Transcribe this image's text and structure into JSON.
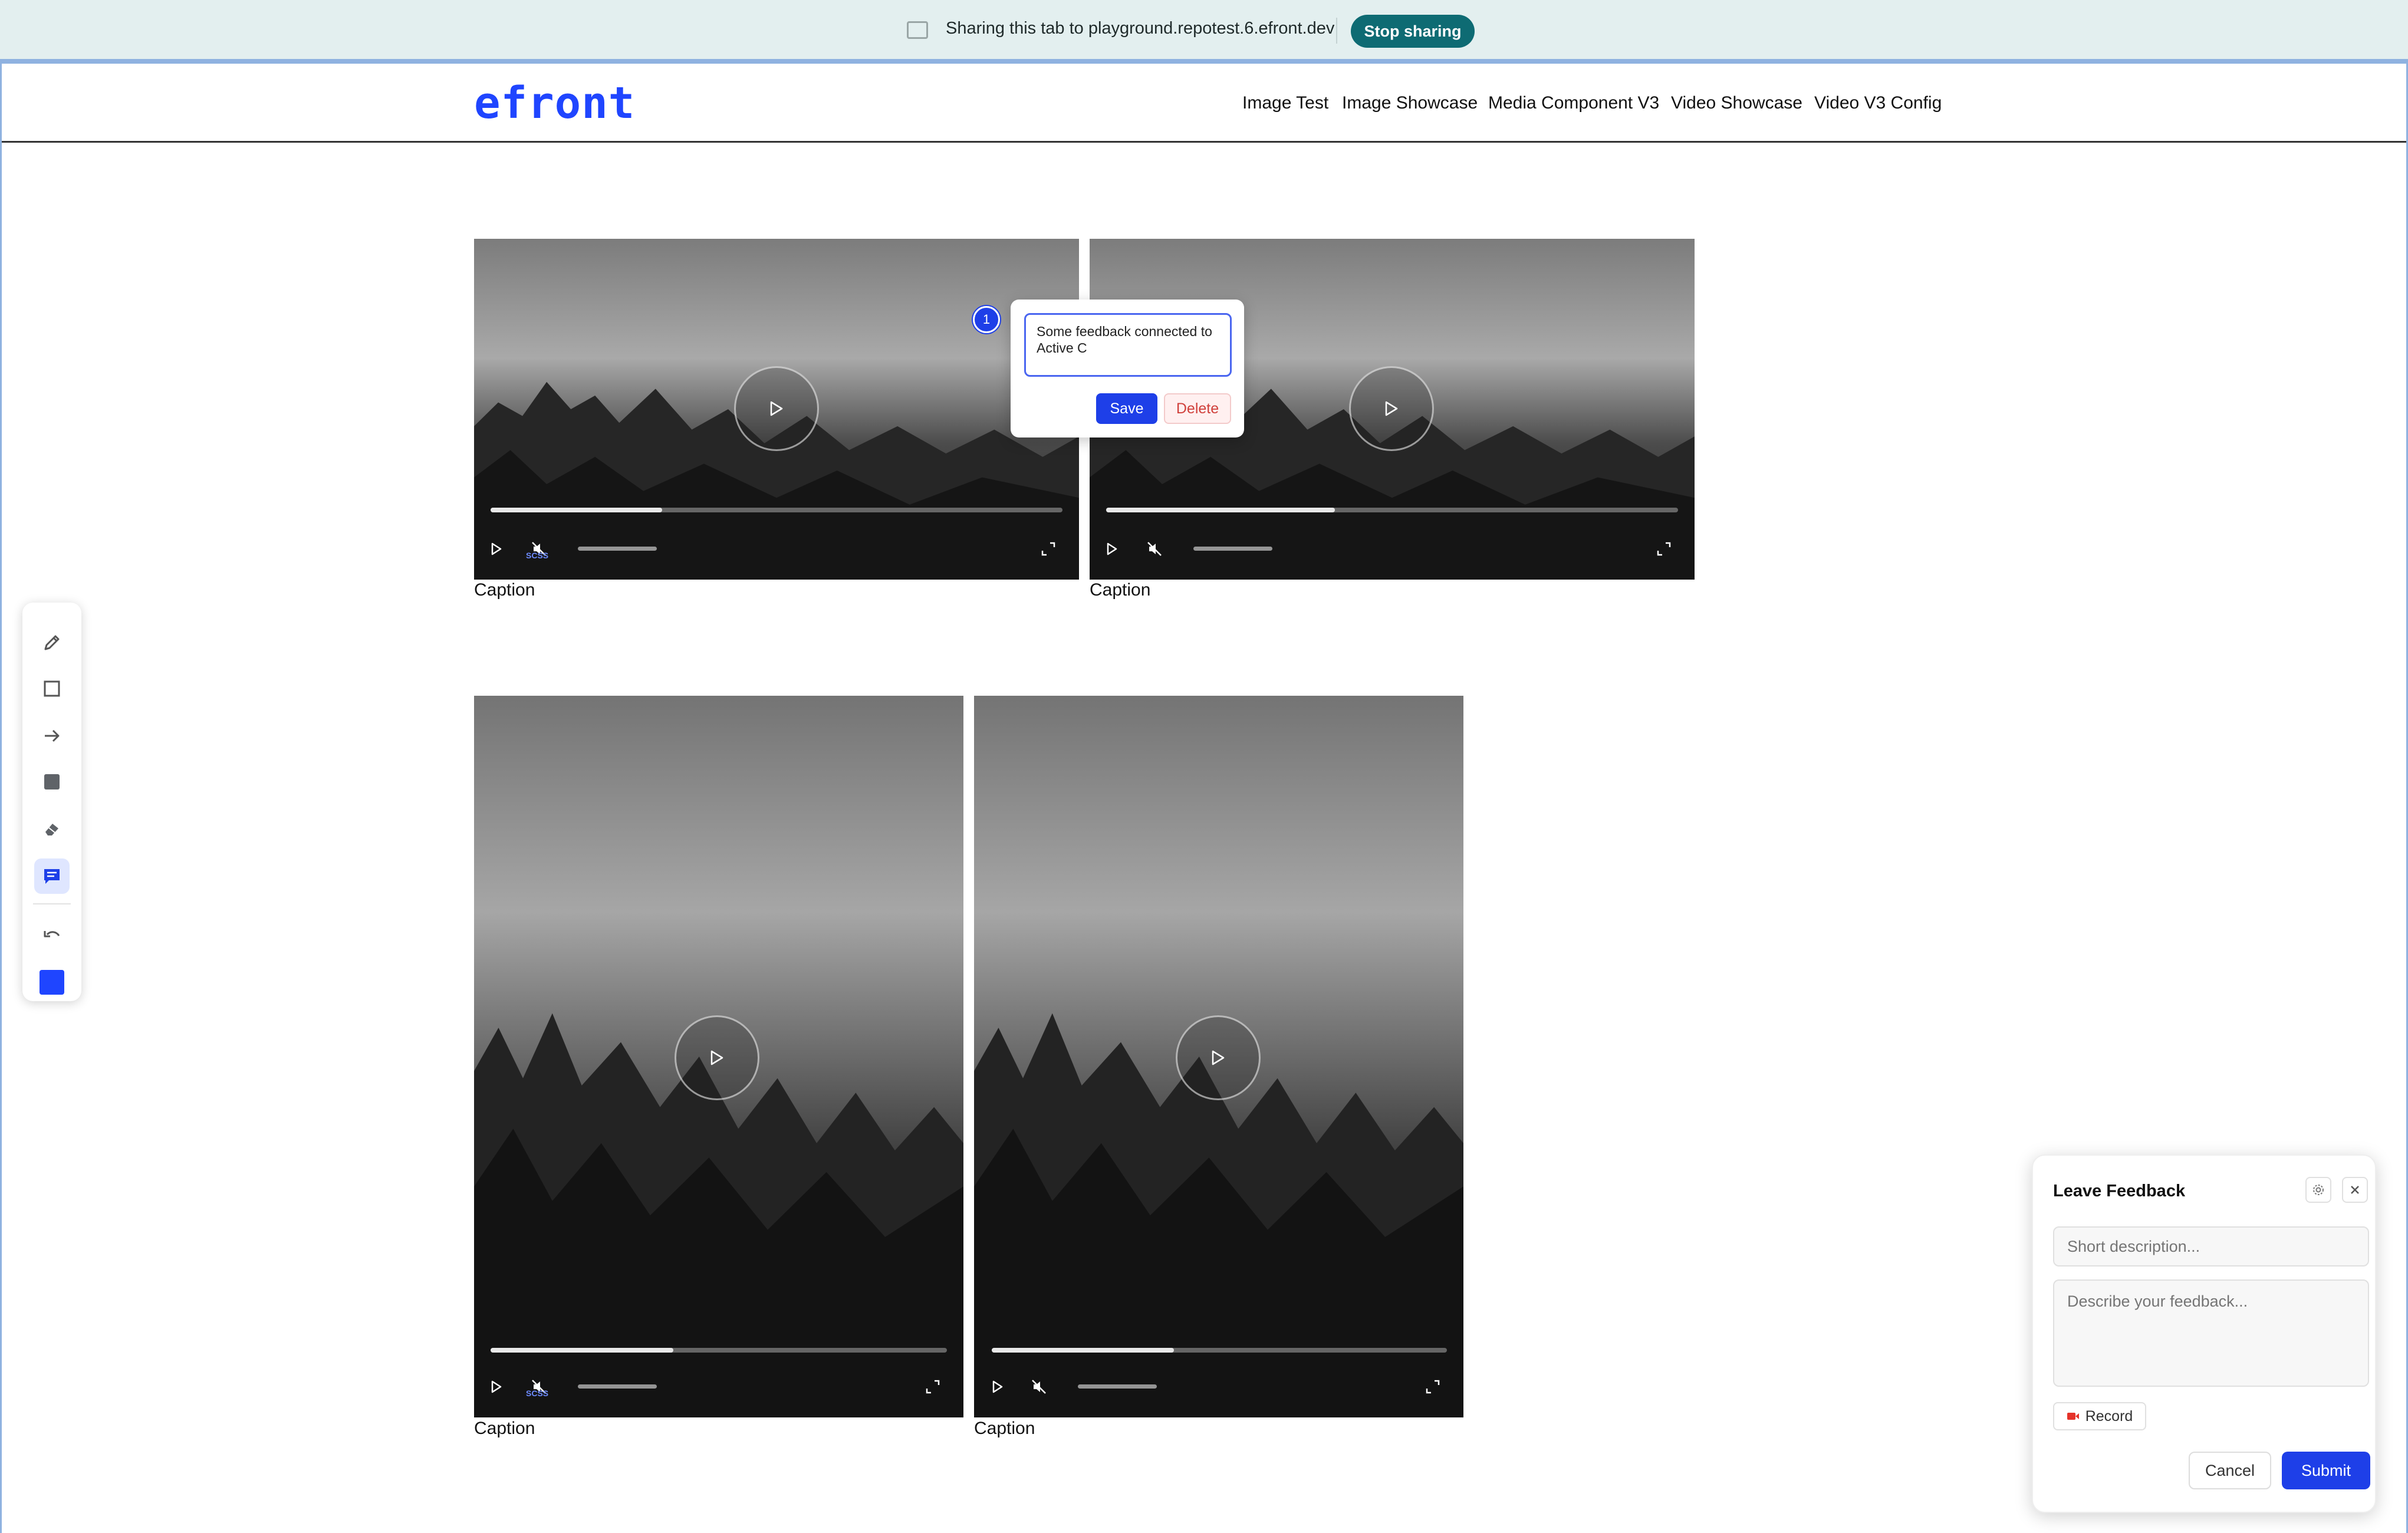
{
  "share_bar": {
    "text": "Sharing this tab to playground.repotest.6.efront.dev",
    "stop_label": "Stop sharing",
    "icon": "screen-share-icon"
  },
  "header": {
    "logo": "efront",
    "nav": [
      "Image Test",
      "Image Showcase",
      "Media Component V3",
      "Video Showcase",
      "Video V3 Config"
    ]
  },
  "videos": [
    {
      "caption": "Caption",
      "progress": 0.3,
      "overlay_label": "SCSS"
    },
    {
      "caption": "Caption",
      "progress": 0.4,
      "overlay_label": ""
    },
    {
      "caption": "Caption",
      "progress": 0.4,
      "overlay_label": "SCSS"
    },
    {
      "caption": "Caption",
      "progress": 0.4,
      "overlay_label": ""
    }
  ],
  "toolbar": {
    "tools": [
      "pencil-icon",
      "rectangle-icon",
      "arrow-icon",
      "filled-rectangle-icon",
      "eraser-icon",
      "comment-icon",
      "undo-icon",
      "color-swatch"
    ],
    "active_tool": "comment-icon",
    "color": "#1f45ff"
  },
  "comment": {
    "pin_number": "1",
    "text": "Some feedback connected to Active C",
    "save_label": "Save",
    "delete_label": "Delete"
  },
  "feedback": {
    "title": "Leave Feedback",
    "short_placeholder": "Short description...",
    "long_placeholder": "Describe your feedback...",
    "record_label": "Record",
    "cancel_label": "Cancel",
    "submit_label": "Submit"
  },
  "colors": {
    "accent": "#1e3fe8",
    "share_button": "#0e6b73",
    "logo": "#1f45ff"
  }
}
